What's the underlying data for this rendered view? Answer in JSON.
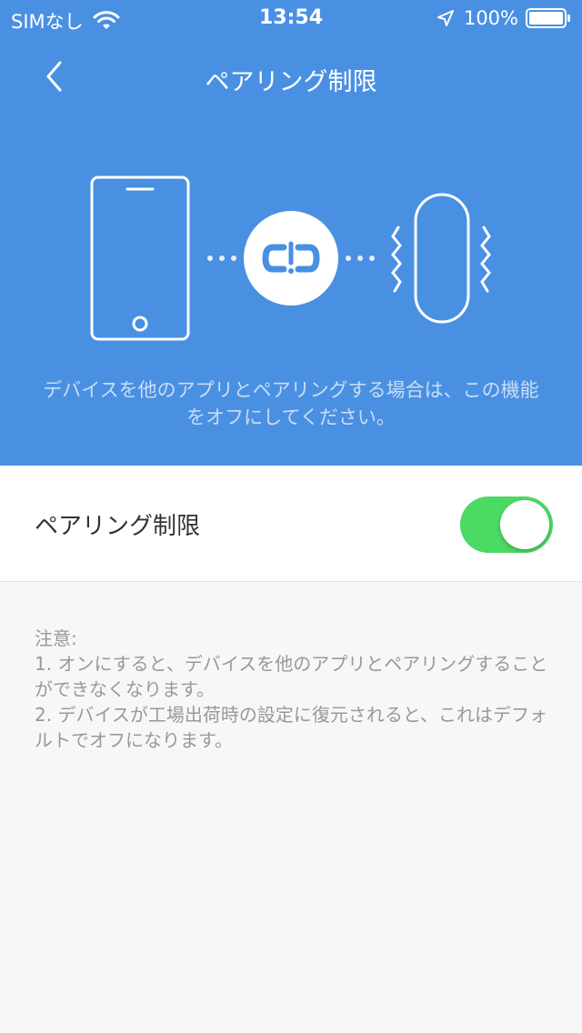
{
  "status_bar": {
    "carrier": "SIMなし",
    "time": "13:54",
    "battery": "100%",
    "wifi_icon": "wifi-icon",
    "location_icon": "location-arrow-icon",
    "battery_icon": "battery-icon"
  },
  "nav": {
    "title": "ペアリング制限",
    "back_icon": "chevron-left-icon"
  },
  "header": {
    "description": "デバイスを他のアプリとペアリングする場合は、この機能をオフにしてください。",
    "background_color": "#4a90e2",
    "icons": [
      "phone-icon",
      "broken-link-icon",
      "band-device-icon",
      "vibration-icon"
    ]
  },
  "setting": {
    "label": "ペアリング制限",
    "toggle_state": "on",
    "toggle_color": "#4cd964"
  },
  "notes": {
    "heading": "注意:",
    "item1": " 1. オンにすると、デバイスを他のアプリとペアリングすることができなくなります。",
    "item2": " 2. デバイスが工場出荷時の設定に復元されると、これはデフォルトでオフになります。"
  }
}
